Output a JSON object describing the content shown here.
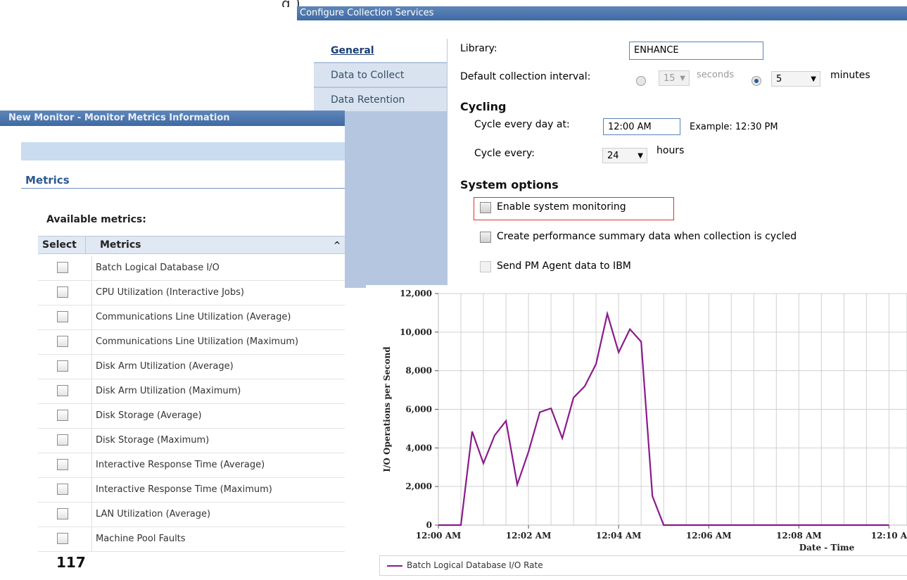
{
  "top_slice": "g )",
  "configure_window": {
    "title": "Configure Collection Services",
    "tabs": [
      {
        "label": "General",
        "active": true
      },
      {
        "label": "Data to Collect",
        "active": false
      },
      {
        "label": "Data Retention",
        "active": false
      }
    ],
    "library_label": "Library:",
    "library_value": "ENHANCE",
    "interval_label": "Default collection interval:",
    "seconds_value": "15",
    "seconds_label": "seconds",
    "minutes_value": "5",
    "minutes_label": "minutes",
    "cycling_heading": "Cycling",
    "cycle_day_label": "Cycle every day at:",
    "cycle_day_value": "12:00 AM",
    "cycle_day_example": "Example: 12:30 PM",
    "cycle_every_label": "Cycle every:",
    "cycle_every_value": "24",
    "cycle_every_unit": "hours",
    "system_options_heading": "System options",
    "options": [
      {
        "label": "Enable system monitoring",
        "checked": false
      },
      {
        "label": "Create performance summary data when collection is cycled",
        "checked": false
      },
      {
        "label": "Send PM Agent data to IBM",
        "checked": false
      }
    ]
  },
  "monitor_window": {
    "title": "New Monitor - Monitor Metrics Information",
    "section_heading": "Metrics",
    "available_label": "Available metrics:",
    "col_select": "Select",
    "col_metrics": "Metrics",
    "metrics": [
      "Batch Logical Database I/O",
      "CPU Utilization (Interactive Jobs)",
      "Communications Line Utilization (Average)",
      "Communications Line Utilization (Maximum)",
      "Disk Arm Utilization (Average)",
      "Disk Arm Utilization (Maximum)",
      "Disk Storage (Average)",
      "Disk Storage (Maximum)",
      "Interactive Response Time (Average)",
      "Interactive Response Time (Maximum)",
      "LAN Utilization (Average)",
      "Machine Pool Faults"
    ]
  },
  "page_number": "117",
  "colors": {
    "series": "#8b1a8b",
    "titlebar": "#4a74ab",
    "highlight": "#e03030"
  },
  "chart_data": {
    "type": "line",
    "title": "",
    "xlabel": "Date - Time",
    "ylabel": "I/O Operations per Second",
    "ylim": [
      0,
      12000
    ],
    "yticks": [
      "0",
      "2,000",
      "4,000",
      "6,000",
      "8,000",
      "10,000",
      "12,000"
    ],
    "xticks": [
      "12:00 AM",
      "12:02 AM",
      "12:04 AM",
      "12:06 AM",
      "12:08 AM",
      "12:10 A"
    ],
    "grid": true,
    "legend_position": "bottom",
    "series": [
      {
        "name": "Batch Logical Database I/O Rate",
        "x": [
          0,
          0.25,
          0.5,
          0.75,
          1.0,
          1.25,
          1.5,
          1.75,
          2.0,
          2.25,
          2.5,
          2.75,
          3.0,
          3.25,
          3.5,
          3.75,
          4.0,
          4.25,
          4.5,
          4.75,
          5.0,
          5.25,
          5.5,
          5.75,
          6.0,
          7.0,
          8.0,
          9.0,
          10.0
        ],
        "values": [
          0,
          0,
          0,
          4850,
          3200,
          4650,
          5400,
          2100,
          3800,
          5850,
          6050,
          4500,
          6600,
          7200,
          8350,
          10950,
          8950,
          10150,
          9500,
          1500,
          0,
          0,
          0,
          0,
          0,
          0,
          0,
          0,
          0
        ]
      }
    ]
  }
}
